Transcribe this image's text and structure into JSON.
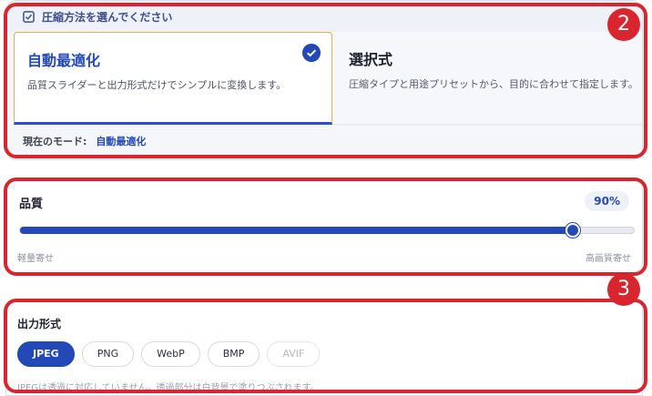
{
  "method": {
    "header": "圧縮方法を選んでください",
    "modes": [
      {
        "title": "自動最適化",
        "description": "品質スライダーと出力形式だけでシンプルに変換します。",
        "selected": true
      },
      {
        "title": "選択式",
        "description": "圧縮タイプと用途プリセットから、目的に合わせて指定します。",
        "selected": false
      }
    ],
    "current_mode_label": "現在のモード:",
    "current_mode_value": "自動最適化"
  },
  "quality": {
    "title": "品質",
    "value_text": "90%",
    "value": 0.9,
    "min_label": "軽量寄せ",
    "max_label": "高画質寄せ"
  },
  "format": {
    "title": "出力形式",
    "options": [
      "JPEG",
      "PNG",
      "WebP",
      "BMP",
      "AVIF"
    ],
    "selected": "JPEG",
    "disabled": [
      "AVIF"
    ],
    "note": "JPEGは透過に対応していません。透過部分は白背景で塗りつぶされます。"
  },
  "annotations": [
    "2",
    "3"
  ],
  "colors": {
    "accent": "#2348b8",
    "annotation": "#d9252d",
    "selected_border": "#e0b24a"
  },
  "icons": {
    "header": "checkbox-icon",
    "selected": "checkmark-icon"
  }
}
